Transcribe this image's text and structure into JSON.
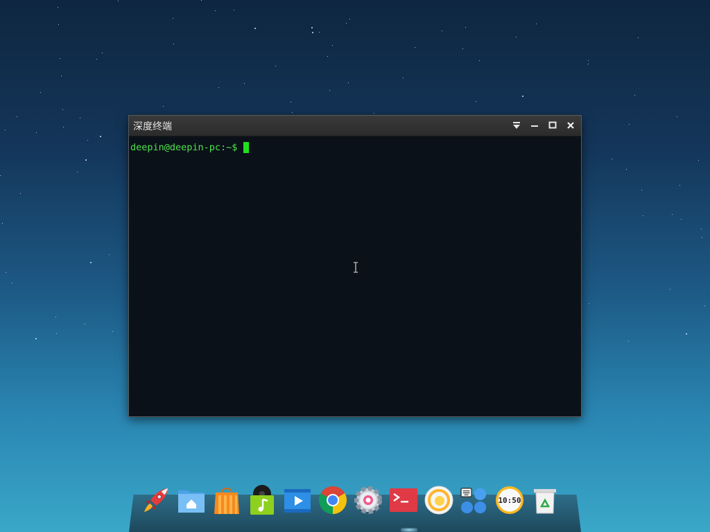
{
  "window": {
    "title": "深度终端",
    "buttons": [
      "menu-icon",
      "minimize-icon",
      "maximize-icon",
      "close-icon"
    ]
  },
  "terminal": {
    "prompt": "deepin@deepin-pc:~$",
    "prompt_color": "#4ee44e",
    "cursor_color": "#1fe01f",
    "background": "#0b1118"
  },
  "dock": {
    "items": [
      {
        "name": "launcher",
        "icon": "rocket-icon"
      },
      {
        "name": "file-manager",
        "icon": "folder-home-icon"
      },
      {
        "name": "app-store",
        "icon": "shopping-bag-icon"
      },
      {
        "name": "music",
        "icon": "music-note-icon"
      },
      {
        "name": "movie",
        "icon": "video-player-icon"
      },
      {
        "name": "google-chrome",
        "icon": "chrome-icon"
      },
      {
        "name": "system-settings",
        "icon": "gear-icon"
      },
      {
        "name": "terminal",
        "icon": "terminal-icon"
      },
      {
        "name": "screenshot",
        "icon": "screenshot-icon"
      },
      {
        "name": "input-method",
        "icon": "keyboard-bubbles-icon"
      },
      {
        "name": "clock",
        "icon": "clock-icon",
        "label": "10:50"
      },
      {
        "name": "trash",
        "icon": "trash-icon"
      }
    ]
  }
}
